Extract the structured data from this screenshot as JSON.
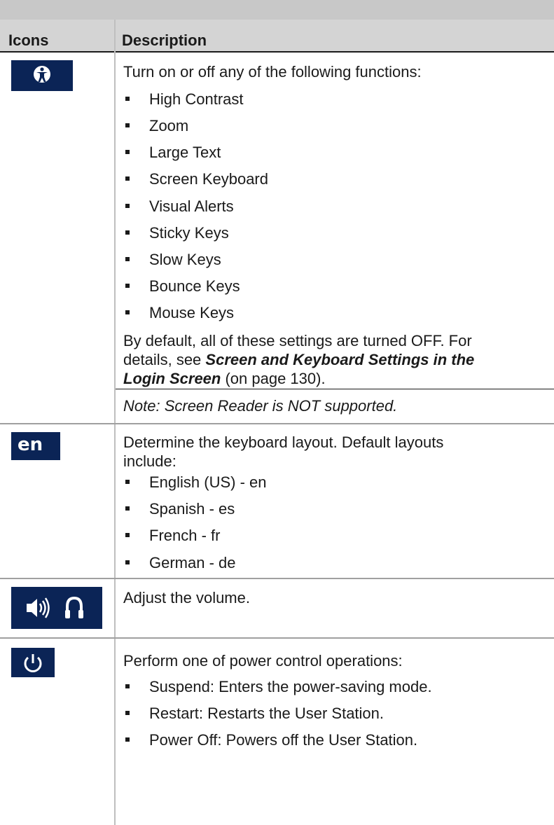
{
  "header": {
    "icons": "Icons",
    "description": "Description"
  },
  "rows": [
    {
      "icon": "accessibility-icon",
      "intro": "Turn on or off any of the following functions:",
      "items": [
        "High Contrast",
        "Zoom",
        "Large Text",
        "Screen Keyboard",
        "Visual Alerts",
        "Sticky Keys",
        "Slow Keys",
        "Bounce Keys",
        "Mouse Keys"
      ],
      "para_line1": "By default, all of these settings are turned OFF. For",
      "para_pre": "details, see ",
      "para_link1": "Screen and Keyboard Settings in the",
      "para_link2": "Login Screen",
      "para_post": " (on page 130).",
      "note": "Note: Screen Reader is NOT supported."
    },
    {
      "icon": "keyboard-layout-icon",
      "icon_text": "en",
      "intro_line1": "Determine the keyboard layout. Default layouts",
      "intro_line2": "include:",
      "items": [
        "English (US) - en",
        "Spanish - es",
        "French - fr",
        "German - de"
      ]
    },
    {
      "icons": [
        "volume-icon",
        "headphones-icon"
      ],
      "intro": "Adjust the volume."
    },
    {
      "icon": "power-icon",
      "intro": "Perform one of power control operations:",
      "items": [
        "Suspend: Enters the power-saving mode.",
        "Restart: Restarts the User Station.",
        "Power Off: Powers off the User Station."
      ]
    }
  ]
}
